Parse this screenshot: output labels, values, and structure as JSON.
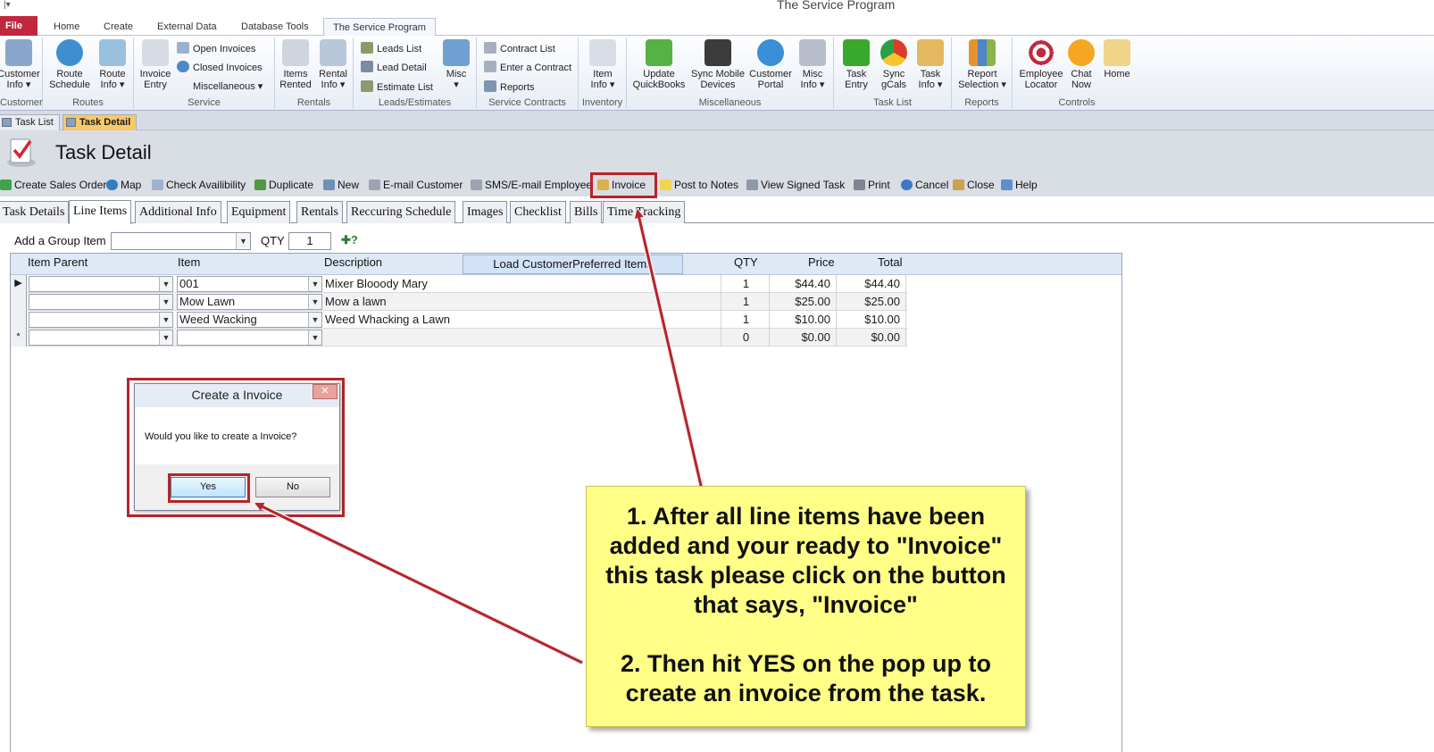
{
  "window": {
    "title": "The Service Program"
  },
  "ribbon_tabs": [
    "File",
    "Home",
    "Create",
    "External Data",
    "Database Tools",
    "The Service Program"
  ],
  "ribbon_groups": {
    "customer": {
      "label": "Customer",
      "btn": "Customer\nInfo ▾"
    },
    "routes": {
      "label": "Routes",
      "btn1": "Route\nSchedule",
      "btn2": "Route\nInfo ▾"
    },
    "service": {
      "label": "Service",
      "btn": "Invoice\nEntry",
      "open": "Open Invoices",
      "closed": "Closed Invoices",
      "misc": "Miscellaneous ▾"
    },
    "rentals": {
      "label": "Rentals",
      "btn1": "Items\nRented",
      "btn2": "Rental\nInfo ▾"
    },
    "leads": {
      "label": "Leads/Estimates",
      "list": "Leads List",
      "detail": "Lead Detail",
      "est": "Estimate List",
      "misc": "Misc\n▾"
    },
    "contracts": {
      "label": "Service Contracts",
      "list": "Contract List",
      "enter": "Enter a Contract",
      "reports": "Reports"
    },
    "inventory": {
      "label": "Inventory",
      "btn": "Item\nInfo ▾"
    },
    "misc": {
      "label": "Miscellaneous",
      "qb": "Update\nQuickBooks",
      "sync": "Sync Mobile\nDevices",
      "portal": "Customer\nPortal",
      "mi": "Misc\nInfo ▾"
    },
    "tasklist": {
      "label": "Task List",
      "entry": "Task\nEntry",
      "gcal": "Sync\ngCals",
      "info": "Task\nInfo ▾"
    },
    "reports": {
      "label": "Reports",
      "sel": "Report\nSelection ▾"
    },
    "controls": {
      "label": "Controls",
      "loc": "Employee\nLocator",
      "chat": "Chat\nNow",
      "home": "Home"
    }
  },
  "doc_tabs": [
    "Task List",
    "Task Detail"
  ],
  "form": {
    "title": "Task Detail"
  },
  "toolbar": [
    "Create Sales Order",
    "Map",
    "Check Availibility",
    "Duplicate",
    "New",
    "E-mail Customer",
    "SMS/E-mail Employee",
    "Invoice",
    "Post to Notes",
    "View Signed Task",
    "Print",
    "Cancel",
    "Close",
    "Help"
  ],
  "form_tabs": [
    "Task Details",
    "Line Items",
    "Additional Info",
    "Equipment",
    "Rentals",
    "Reccuring Schedule",
    "Images",
    "Checklist",
    "Bills",
    "Time Tracking"
  ],
  "group_row": {
    "label": "Add a Group Item",
    "qty_label": "QTY",
    "qty_value": "1"
  },
  "sheet": {
    "headers": {
      "parent": "Item Parent",
      "item": "Item",
      "desc": "Description",
      "qty": "QTY",
      "price": "Price",
      "total": "Total"
    },
    "load_button": "Load CustomerPreferred Items",
    "rows": [
      {
        "sel": "▶",
        "parent": "",
        "item": "001",
        "desc": "Mixer Blooody Mary",
        "qty": "1",
        "price": "$44.40",
        "total": "$44.40"
      },
      {
        "sel": "",
        "parent": "",
        "item": "Mow Lawn",
        "desc": "Mow a lawn",
        "qty": "1",
        "price": "$25.00",
        "total": "$25.00"
      },
      {
        "sel": "",
        "parent": "",
        "item": "Weed Wacking",
        "desc": "Weed Whacking a Lawn",
        "qty": "1",
        "price": "$10.00",
        "total": "$10.00"
      },
      {
        "sel": "*",
        "parent": "",
        "item": "",
        "desc": "",
        "qty": "0",
        "price": "$0.00",
        "total": "$0.00"
      }
    ]
  },
  "dialog": {
    "title": "Create a Invoice",
    "message": "Would you like to create a Invoice?",
    "yes": "Yes",
    "no": "No",
    "close": "✕"
  },
  "callout": {
    "step1": "1.  After all line items have been added and your ready to  \"Invoice\" this task please click on the button that says, \"Invoice\"",
    "step2": "2.  Then hit YES on the pop up to create an invoice from the task."
  },
  "colors": {
    "highlight": "#b8232b",
    "callout_bg": "#ffff88",
    "file_tab": "#c1283e",
    "active_doc_tab": "#f7c96a"
  }
}
